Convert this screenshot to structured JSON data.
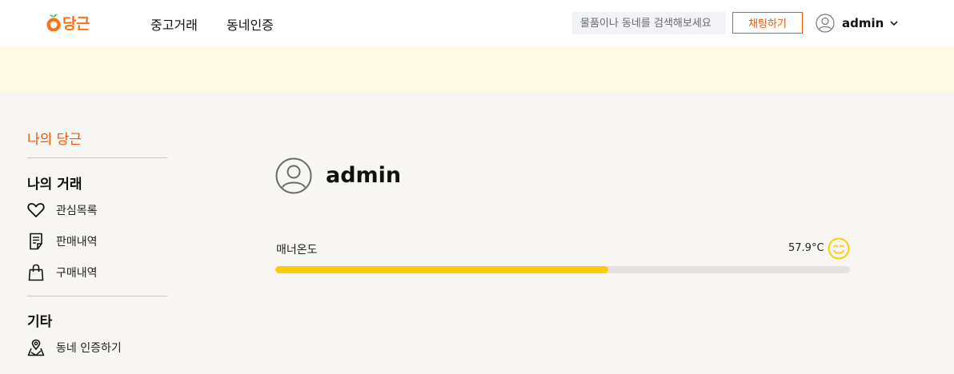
{
  "header": {
    "logo_text": "당근",
    "nav": [
      "중고거래",
      "동네인증"
    ],
    "search_placeholder": "물품이나 동네를 검색해보세요",
    "chat_button": "채팅하기",
    "user_name": "admin"
  },
  "sidebar": {
    "title": "나의 당근",
    "sections": [
      {
        "title": "나의 거래",
        "items": [
          {
            "label": "관심목록",
            "icon": "heart-icon"
          },
          {
            "label": "판매내역",
            "icon": "receipt-icon"
          },
          {
            "label": "구매내역",
            "icon": "shopping-bag-icon"
          }
        ]
      },
      {
        "title": "기타",
        "items": [
          {
            "label": "동네 인증하기",
            "icon": "map-pin-icon"
          }
        ]
      }
    ]
  },
  "profile": {
    "name": "admin",
    "manner_label": "매너온도",
    "manner_temp": "57.9°C",
    "manner_fraction": 0.579
  },
  "colors": {
    "brand": "#ff6f0f",
    "accent": "#e8590c",
    "bar": "#ffcb05",
    "banner": "#fef9e2"
  }
}
